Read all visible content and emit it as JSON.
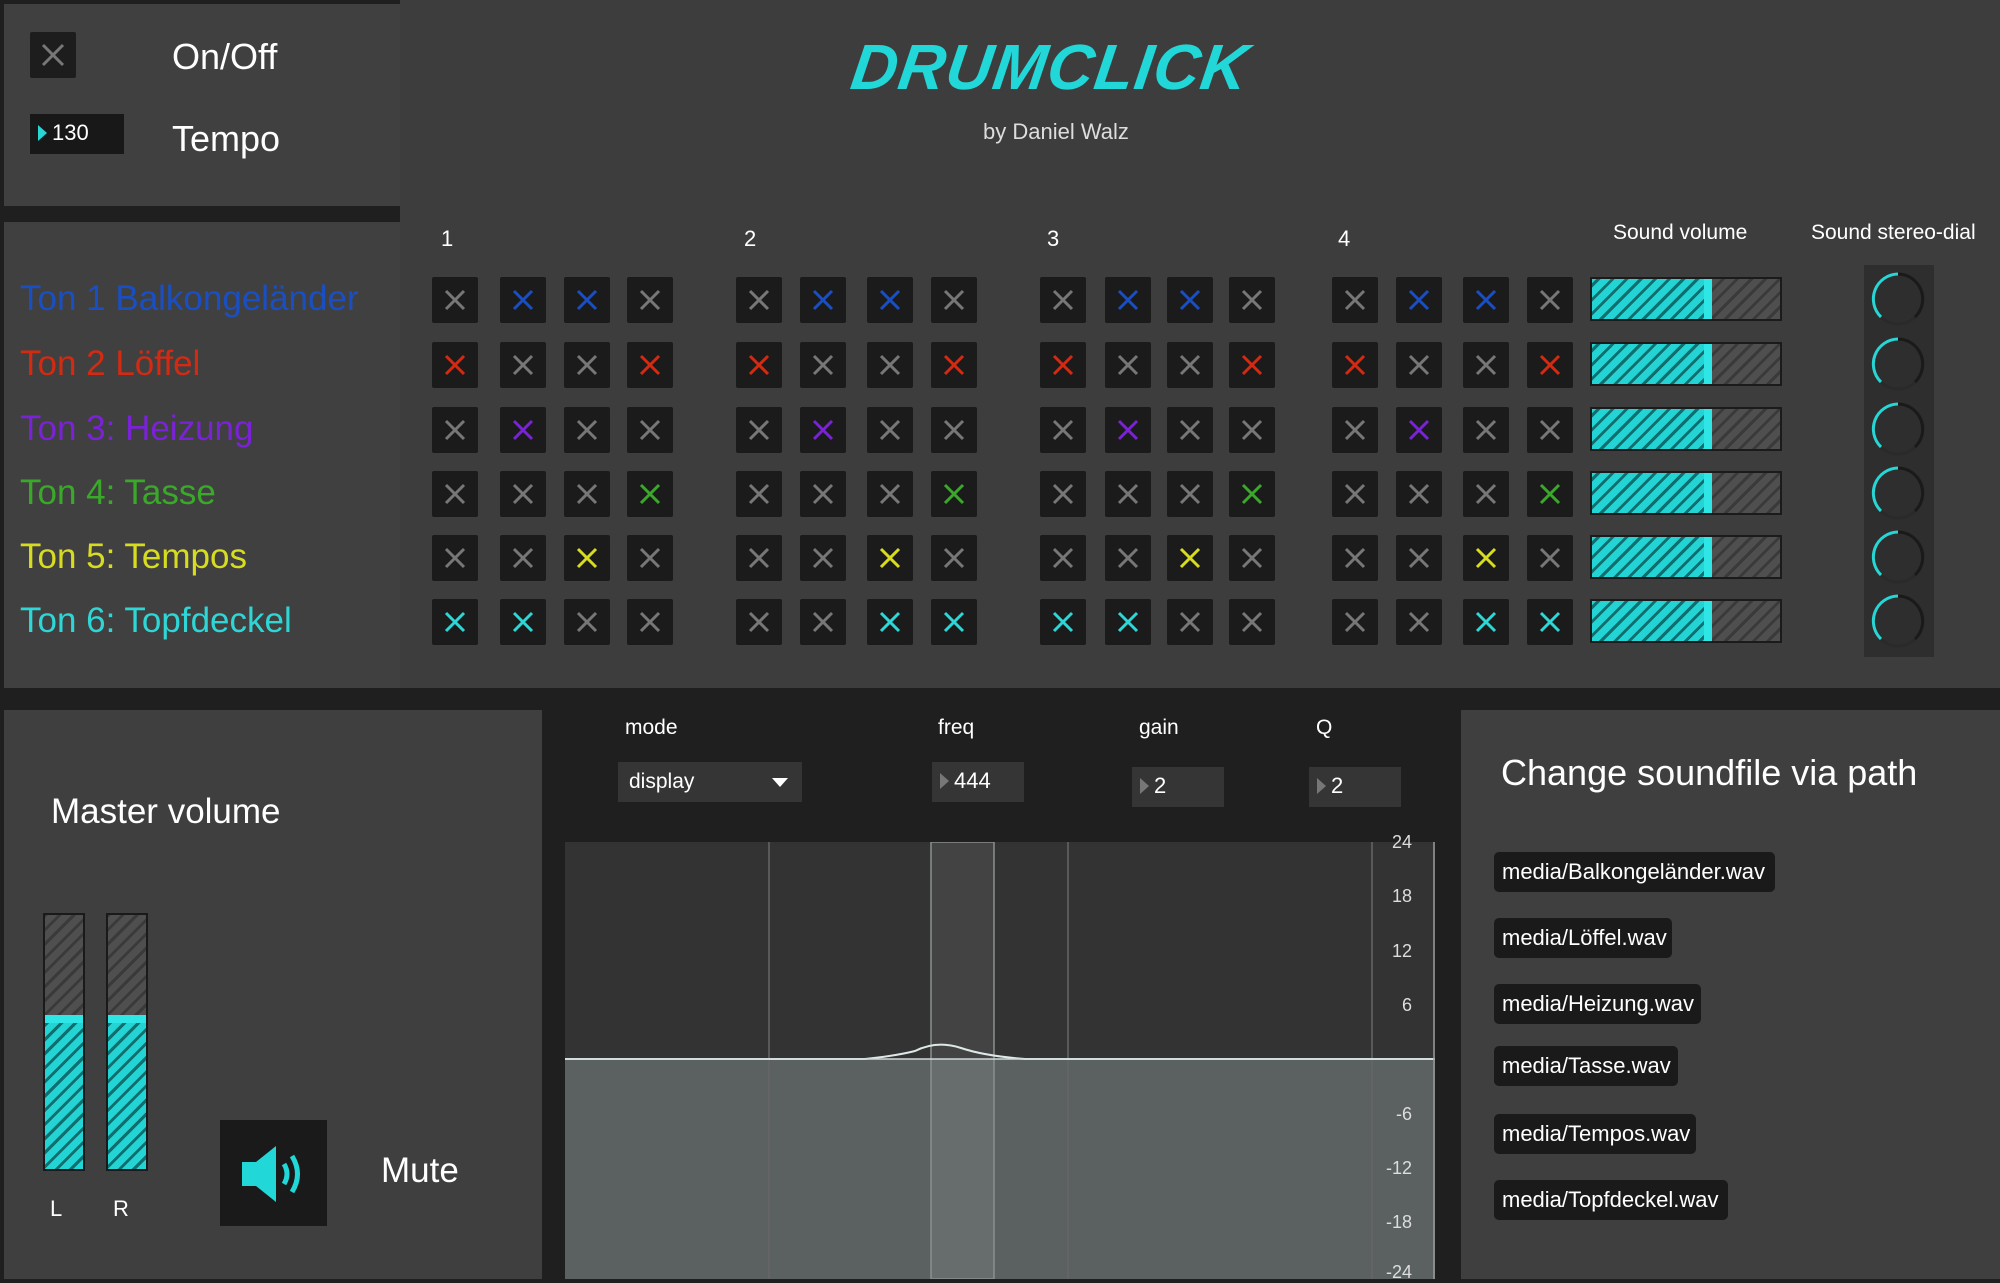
{
  "header": {
    "onoff_label": "On/Off",
    "tempo_label": "Tempo",
    "tempo_value": "130",
    "logo_text": "DRUMCLICK",
    "byline": "by Daniel Walz"
  },
  "sequencer": {
    "beat_labels": [
      "1",
      "2",
      "3",
      "4"
    ],
    "volume_header": "Sound volume",
    "stereo_header": "Sound stereo-dial",
    "tracks": [
      {
        "label": "Ton 1 Balkongeländer",
        "color": "#1a4fc4",
        "steps": [
          0,
          1,
          1,
          0,
          0,
          1,
          1,
          0,
          0,
          1,
          1,
          0,
          0,
          1,
          1,
          0
        ],
        "volume": 0.64
      },
      {
        "label": "Ton 2 Löffel",
        "color": "#d42a12",
        "steps": [
          1,
          0,
          0,
          1,
          1,
          0,
          0,
          1,
          1,
          0,
          0,
          1,
          1,
          0,
          0,
          1
        ],
        "volume": 0.64
      },
      {
        "label": "Ton 3: Heizung",
        "color": "#7a22d6",
        "steps": [
          0,
          1,
          0,
          0,
          0,
          1,
          0,
          0,
          0,
          1,
          0,
          0,
          0,
          1,
          0,
          0
        ],
        "volume": 0.64
      },
      {
        "label": "Ton 4: Tasse",
        "color": "#3aa92a",
        "steps": [
          0,
          0,
          0,
          1,
          0,
          0,
          0,
          1,
          0,
          0,
          0,
          1,
          0,
          0,
          0,
          1
        ],
        "volume": 0.64
      },
      {
        "label": "Ton 5: Tempos",
        "color": "#d8dc20",
        "steps": [
          0,
          0,
          1,
          0,
          0,
          0,
          1,
          0,
          0,
          0,
          1,
          0,
          0,
          0,
          1,
          0
        ],
        "volume": 0.64
      },
      {
        "label": "Ton 6: Topfdeckel",
        "color": "#2fd6d6",
        "steps": [
          1,
          1,
          0,
          0,
          0,
          0,
          1,
          1,
          1,
          1,
          0,
          0,
          0,
          0,
          1,
          1
        ],
        "volume": 0.64
      }
    ]
  },
  "master": {
    "title": "Master volume",
    "left_label": "L",
    "right_label": "R",
    "left_level": 0.6,
    "right_level": 0.6,
    "mute_label": "Mute"
  },
  "filter": {
    "mode_label": "mode",
    "mode_value": "display",
    "freq_label": "freq",
    "freq_value": "444",
    "gain_label": "gain",
    "gain_value": "2",
    "q_label": "Q",
    "q_value": "2",
    "y_ticks": [
      "24",
      "18",
      "12",
      "6",
      "-6",
      "-12",
      "-18",
      "-24"
    ]
  },
  "soundfiles": {
    "title": "Change soundfile via path",
    "paths": [
      "media/Balkongeländer.wav",
      "media/Löffel.wav",
      "media/Heizung.wav",
      "media/Tasse.wav",
      "media/Tempos.wav",
      "media/Topfdeckel.wav"
    ]
  },
  "icons": {
    "toggle": "close-x-icon",
    "mute": "speaker-icon",
    "dropdown": "triangle-down-icon"
  }
}
